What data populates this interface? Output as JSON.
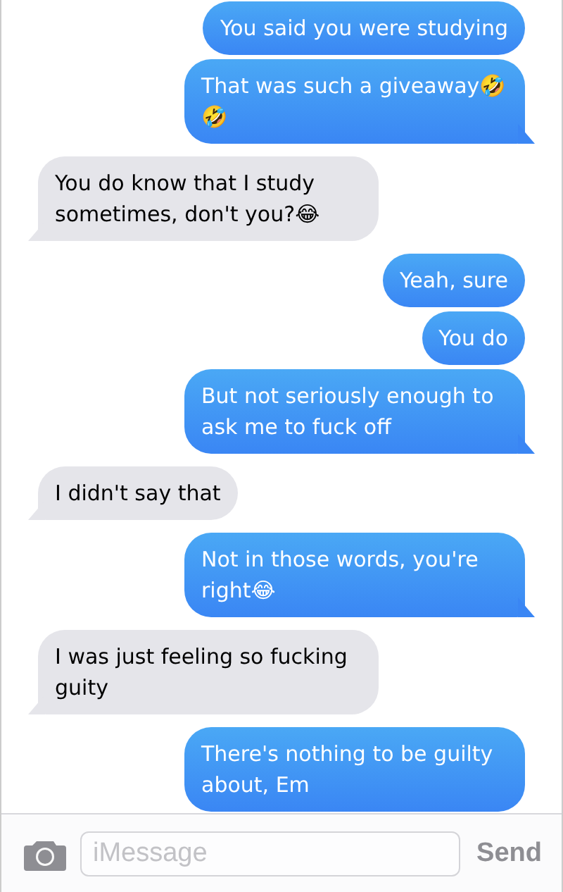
{
  "messages": [
    {
      "kind": "sent",
      "text": "You said you were studying",
      "tail": false
    },
    {
      "kind": "sent",
      "text": "That was such a giveaway🤣🤣",
      "tail": true
    },
    {
      "kind": "received",
      "text": "You do know that I study sometimes, don't you?😂",
      "tail": true
    },
    {
      "kind": "sent",
      "text": "Yeah, sure",
      "tail": false
    },
    {
      "kind": "sent",
      "text": "You do",
      "tail": false
    },
    {
      "kind": "sent",
      "text": "But not seriously enough to ask me to fuck off",
      "tail": true
    },
    {
      "kind": "received",
      "text": "I didn't say that",
      "tail": true
    },
    {
      "kind": "sent",
      "text": "Not in those words, you're right😂",
      "tail": true
    },
    {
      "kind": "received",
      "text": "I was just feeling so fucking guity",
      "tail": true
    },
    {
      "kind": "sent",
      "text": "There's nothing to be guilty about, Em",
      "tail": false
    }
  ],
  "compose": {
    "placeholder": "iMessage",
    "send": "Send"
  }
}
